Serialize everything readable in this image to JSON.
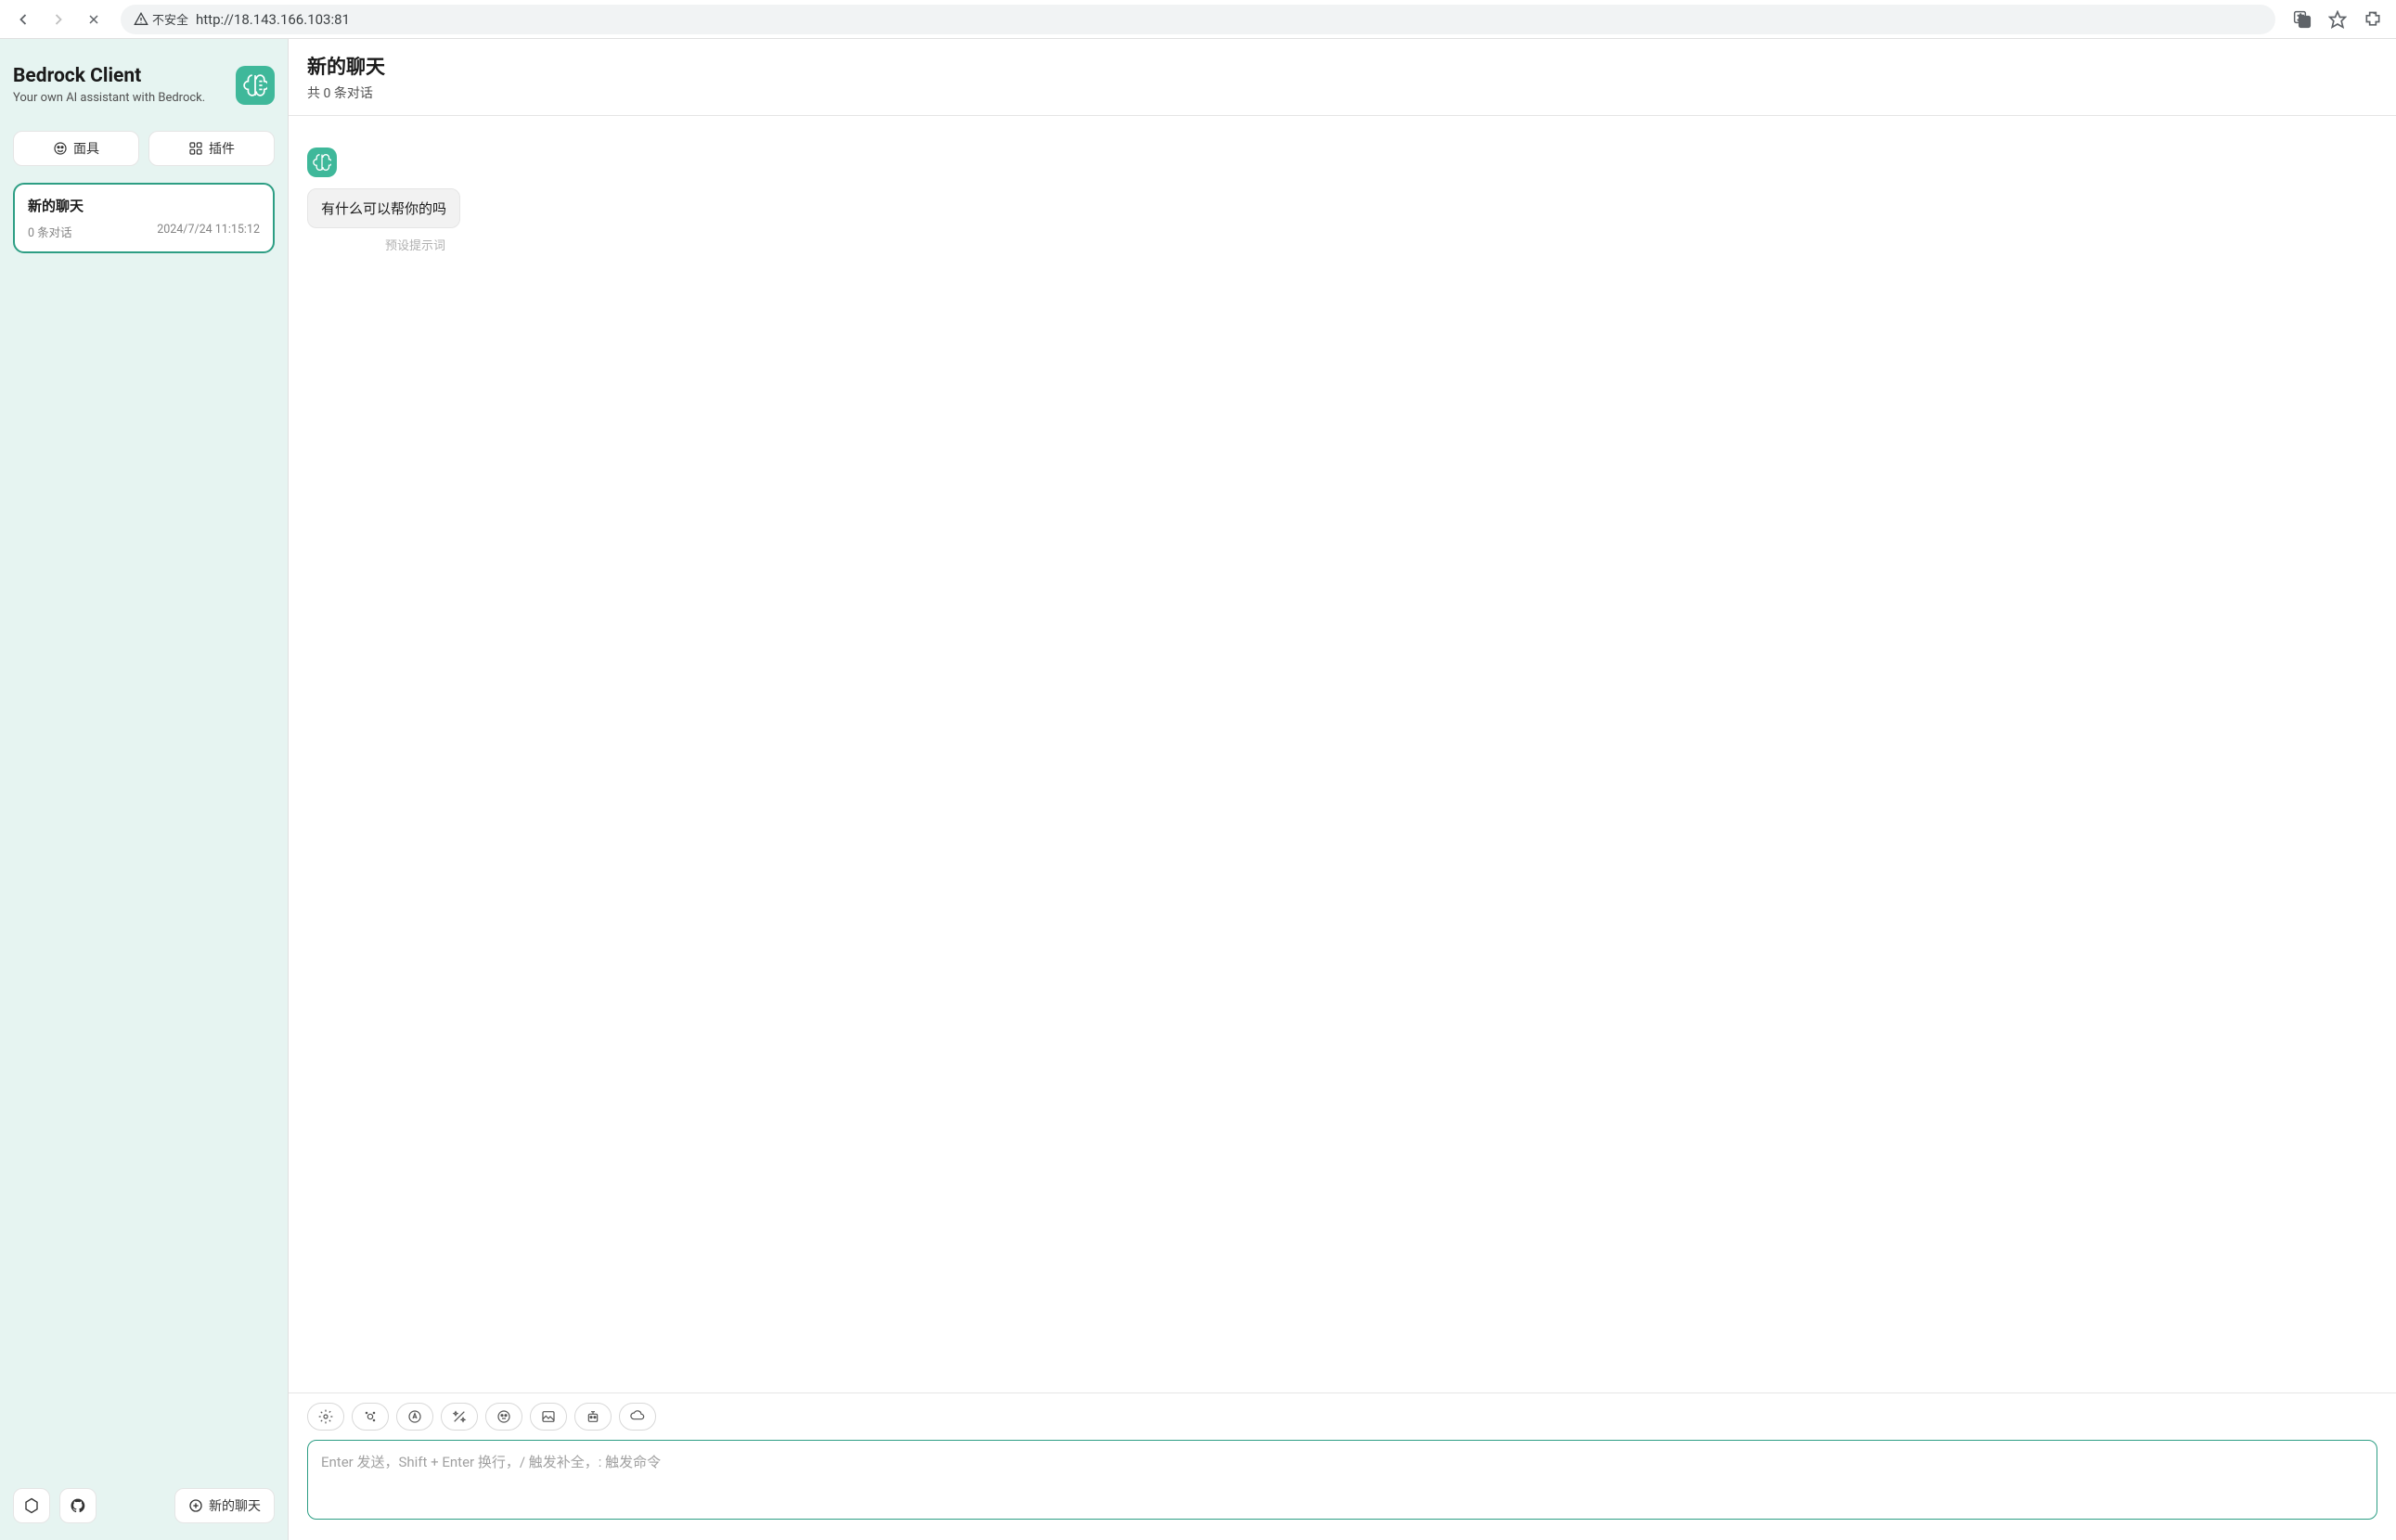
{
  "browser": {
    "insecure_label": "不安全",
    "url": "http://18.143.166.103:81"
  },
  "sidebar": {
    "title": "Bedrock Client",
    "subtitle": "Your own AI assistant with Bedrock.",
    "mask_btn": "面具",
    "plugin_btn": "插件",
    "new_chat_btn": "新的聊天",
    "chats": [
      {
        "title": "新的聊天",
        "count": "0 条对话",
        "timestamp": "2024/7/24 11:15:12"
      }
    ]
  },
  "main": {
    "title": "新的聊天",
    "subtitle": "共 0 条对话",
    "greeting": "有什么可以帮你的吗",
    "preset_hint": "预设提示词",
    "input_placeholder": "Enter 发送，Shift + Enter 换行，/ 触发补全，: 触发命令"
  }
}
